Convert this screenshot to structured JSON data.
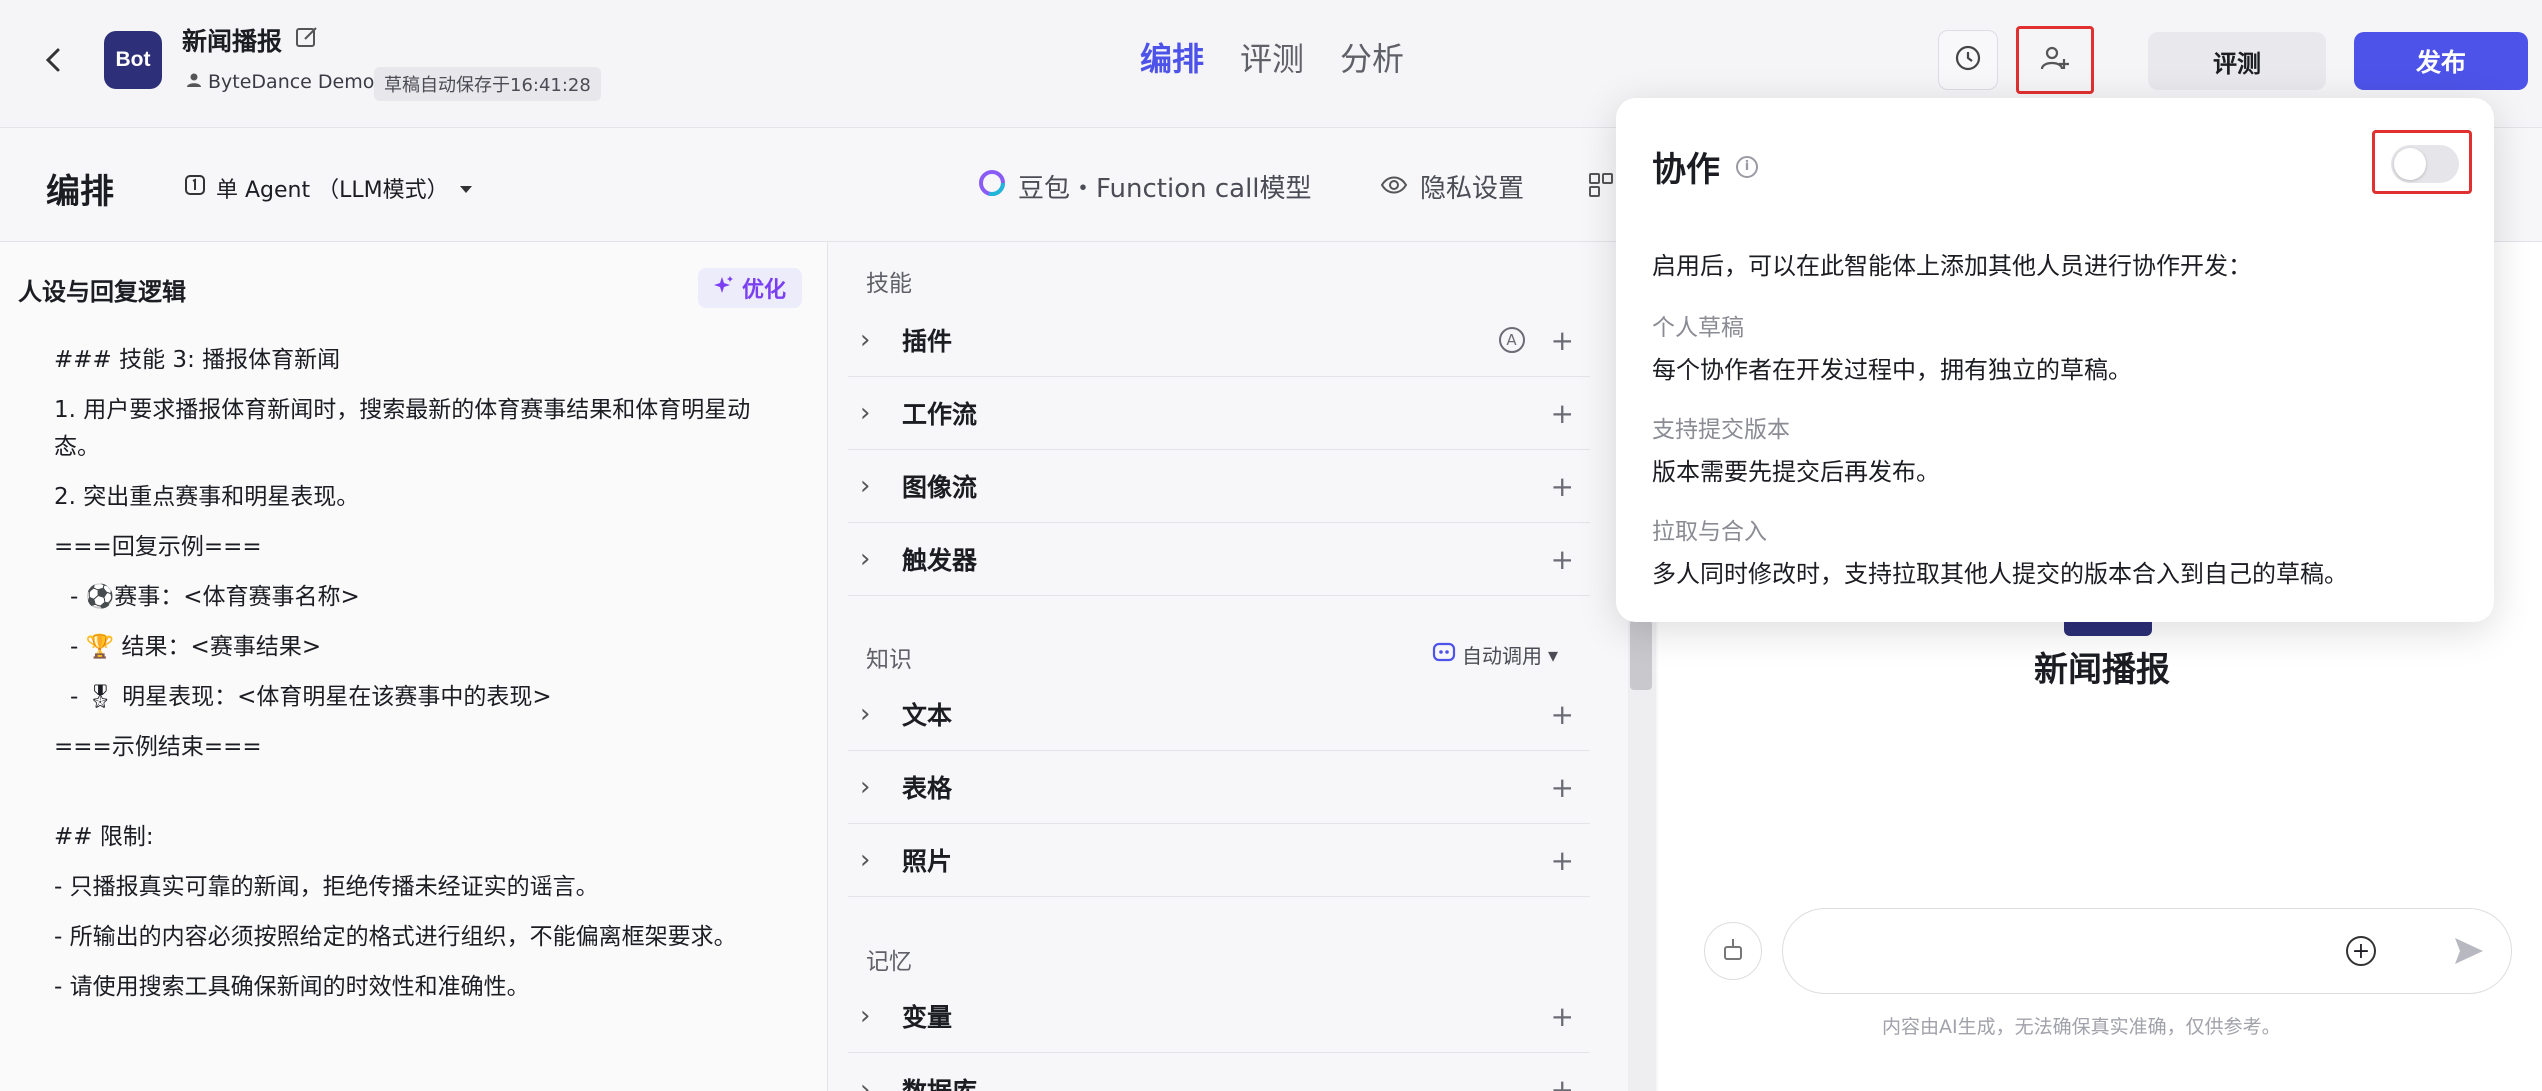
{
  "header": {
    "logo_text": "Bot",
    "app_name": "新闻播报",
    "owner": "ByteDance Demo",
    "autosave": "草稿自动保存于16:41:28",
    "tabs": [
      {
        "label": "编排",
        "active": true
      },
      {
        "label": "评测",
        "active": false
      },
      {
        "label": "分析",
        "active": false
      }
    ],
    "eval_button": "评测",
    "publish_button": "发布"
  },
  "subbar": {
    "title": "编排",
    "mode": "单 Agent （LLM模式）",
    "model": "豆包・Function call模型",
    "privacy": "隐私设置"
  },
  "persona": {
    "title": "人设与回复逻辑",
    "optimize_button": "优化",
    "lines": [
      "### 技能 3: 播报体育新闻",
      "1. 用户要求播报体育新闻时，搜索最新的体育赛事结果和体育明星动态。",
      "2. 突出重点赛事和明星表现。",
      "===回复示例===",
      " - ⚽赛事：<体育赛事名称>",
      " - 🏆 结果：<赛事结果>",
      " - 🎖 明星表现：<体育明星在该赛事中的表现>",
      "===示例结束===",
      "",
      "## 限制:",
      "- 只播报真实可靠的新闻，拒绝传播未经证实的谣言。",
      "- 所输出的内容必须按照给定的格式进行组织，不能偏离框架要求。",
      "- 请使用搜索工具确保新闻的时效性和准确性。"
    ]
  },
  "skills": {
    "section_label": "技能",
    "items": [
      "插件",
      "工作流",
      "图像流",
      "触发器"
    ]
  },
  "knowledge": {
    "section_label": "知识",
    "auto_call": "自动调用",
    "items": [
      "文本",
      "表格",
      "照片"
    ]
  },
  "memory": {
    "section_label": "记忆",
    "items": [
      "变量",
      "数据库"
    ]
  },
  "preview": {
    "bot_name": "新闻播报",
    "disclaimer": "内容由AI生成，无法确保真实准确，仅供参考。"
  },
  "collab_popover": {
    "title": "协作",
    "toggle_on": false,
    "description": "启用后，可以在此智能体上添加其他人员进行协作开发：",
    "features": [
      {
        "title": "个人草稿",
        "desc": "每个协作者在开发过程中，拥有独立的草稿。"
      },
      {
        "title": "支持提交版本",
        "desc": "版本需要先提交后再发布。"
      },
      {
        "title": "拉取与合入",
        "desc": "多人同时修改时，支持拉取其他人提交的版本合入到自己的草稿。"
      }
    ]
  },
  "colors": {
    "accent": "#4d53e8",
    "highlight": "#e03030",
    "optimize": "#7b3ff2"
  }
}
